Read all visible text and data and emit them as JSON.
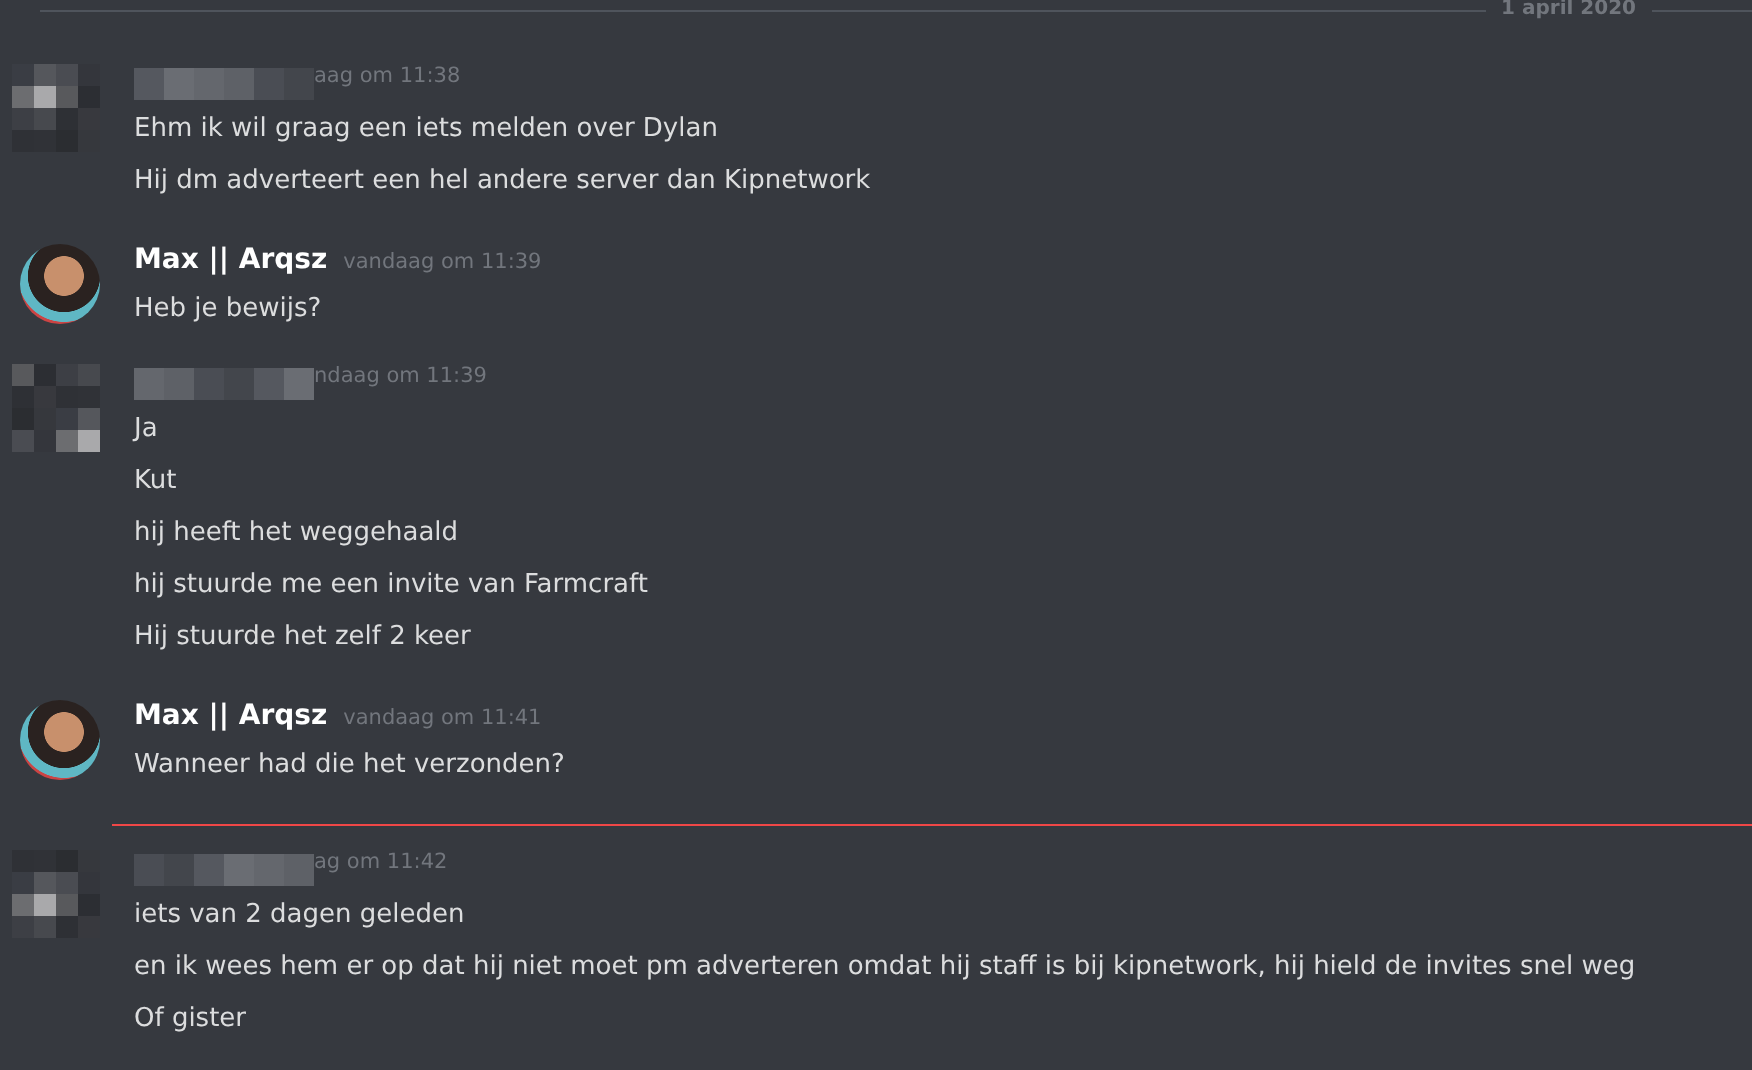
{
  "date_divider": "1 april 2020",
  "messages": [
    {
      "kind": "pixelated",
      "timestamp": "aag om 11:38",
      "new_marker": false,
      "lines": [
        "Ehm ik wil graag een iets melden over Dylan",
        "Hij dm adverteert een hel andere server dan Kipnetwork"
      ]
    },
    {
      "kind": "named",
      "author": "Max || Arqsz",
      "timestamp": "vandaag om 11:39",
      "new_marker": false,
      "lines": [
        "Heb je bewijs?"
      ]
    },
    {
      "kind": "pixelated",
      "timestamp": "ndaag om 11:39",
      "new_marker": false,
      "lines": [
        "Ja",
        "Kut",
        "hij heeft het weggehaald",
        "hij stuurde me een invite van Farmcraft",
        "Hij stuurde het zelf 2 keer"
      ]
    },
    {
      "kind": "named",
      "author": "Max || Arqsz",
      "timestamp": "vandaag om 11:41",
      "new_marker": false,
      "lines": [
        "Wanneer had die het verzonden?"
      ]
    },
    {
      "kind": "pixelated",
      "timestamp": "ag om 11:42",
      "new_marker": true,
      "lines": [
        "iets van 2 dagen geleden",
        "en ik wees hem er op dat hij niet moet pm adverteren omdat hij staff is bij kipnetwork, hij hield de invites snel weg",
        "Of gister"
      ]
    }
  ]
}
